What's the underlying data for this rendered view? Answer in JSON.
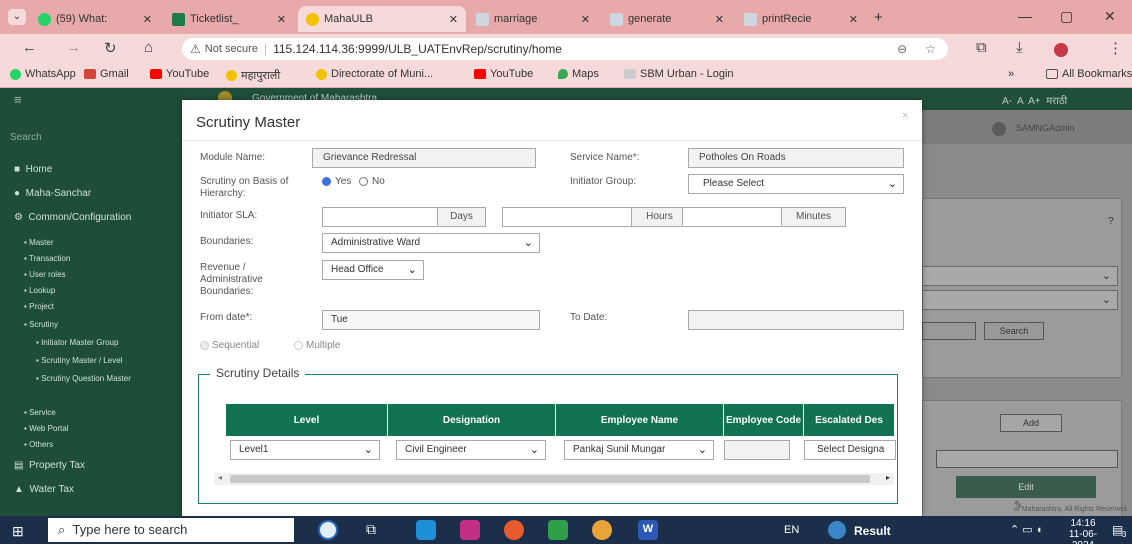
{
  "browser": {
    "tabs": [
      {
        "label": "(59) What:"
      },
      {
        "label": "Ticketlist_"
      },
      {
        "label": "MahaULB"
      },
      {
        "label": "marriage"
      },
      {
        "label": "generate"
      },
      {
        "label": "printRecie"
      }
    ],
    "new_tab": "+",
    "address": {
      "security": "Not secure",
      "url": "115.124.114.36:9999/ULB_UATEnvRep/scrutiny/home"
    },
    "bookmarks": [
      "WhatsApp",
      "Gmail",
      "YouTube",
      "महापुराली",
      "Directorate of Muni...",
      "YouTube",
      "Maps",
      "SBM Urban - Login"
    ],
    "all_bookmarks": "All Bookmarks",
    "more": "»"
  },
  "app": {
    "header_title": "Government of Maharashtra",
    "lang_switch": "A-  A  A+  मराठी",
    "user": "SAMNGAdmin",
    "sidebar": {
      "search": "Search",
      "items": [
        "Home",
        "Maha-Sanchar",
        "Common/Configuration",
        "Master",
        "Transaction",
        "User roles",
        "Lookup",
        "Project",
        "Scrutiny",
        "Initiator Master Group",
        "Scrutiny Master / Level",
        "Scrutiny Question Master",
        "Service",
        "Web Portal",
        "Others",
        "Property Tax",
        "Water Tax"
      ]
    },
    "background": {
      "question_mark": "?",
      "search_button": "Search",
      "add_button": "Add",
      "edit_header": "Edit",
      "footer": "of Maharashtra. All Rights Reserved."
    }
  },
  "modal": {
    "title": "Scrutiny Master",
    "close": "×",
    "module_label": "Module Name:",
    "module_value": "Grievance Redressal",
    "service_label": "Service Name*:",
    "service_value": "Potholes On Roads",
    "scrutiny_basis_label": "Scrutiny on Basis of Hierarchy:",
    "yes_label": "Yes",
    "no_label": "No",
    "initiator_group_label": "Initiator Group:",
    "initiator_group_value": "Please Select",
    "sla_label": "Initiator SLA:",
    "days": "Days",
    "hours": "Hours",
    "minutes": "Minutes",
    "boundaries_label": "Boundaries:",
    "boundaries_value": "Administrative Ward",
    "revenue_label": "Revenue / Administrative Boundaries:",
    "revenue_value": "Head Office",
    "from_date_label": "From date*:",
    "from_date_value": "Tue",
    "to_date_label": "To Date:",
    "sequential": "Sequential",
    "multiple": "Multiple",
    "details_legend": "Scrutiny Details",
    "grid": {
      "headers": [
        "Level",
        "Designation",
        "Employee Name",
        "Employee Code",
        "Escalated Des"
      ],
      "row": {
        "level": "Level1",
        "designation": "Civil Engineer",
        "employee": "Pankaj Sunil Mungar",
        "code": "",
        "escalated": "Select Designa"
      }
    }
  },
  "taskbar": {
    "search_placeholder": "Type here to search",
    "lang": "EN",
    "result": "Result",
    "time": "14:16",
    "date": "11-06-2024",
    "notifications": "3"
  },
  "colors": {
    "accent": "#11734f",
    "sidebar": "#1e4e39",
    "tabbar": "#e7a9a9"
  }
}
